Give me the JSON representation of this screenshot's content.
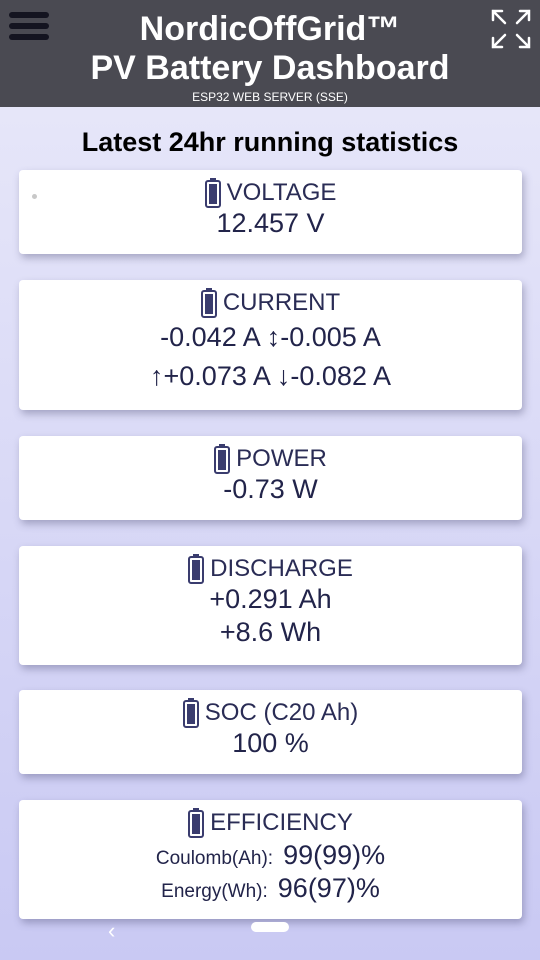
{
  "header": {
    "brand": "NordicOffGrid™",
    "title": "PV Battery Dashboard",
    "subtitle": "ESP32 WEB SERVER (SSE)",
    "menu_icon": "hamburger-menu-icon",
    "expand_icon": "fullscreen-expand-icon"
  },
  "main": {
    "heading": "Latest 24hr running statistics",
    "cards": {
      "voltage": {
        "title": "VOLTAGE",
        "value": "12.457 V"
      },
      "current": {
        "title": "CURRENT",
        "now": "-0.042 A",
        "avg": "↕-0.005 A",
        "max": "↑+0.073 A",
        "min": "↓-0.082 A"
      },
      "power": {
        "title": "POWER",
        "value": "-0.73 W"
      },
      "discharge": {
        "title": "DISCHARGE",
        "ah": "+0.291 Ah",
        "wh": "+8.6 Wh"
      },
      "soc": {
        "title": "SOC (C20 Ah)",
        "value": "100 %"
      },
      "efficiency": {
        "title": "EFFICIENCY",
        "coulomb_label": "Coulomb(Ah):",
        "coulomb_value": "99(99)%",
        "energy_label": "Energy(Wh):",
        "energy_value": "96(97)%"
      }
    },
    "battery_icon": "battery-icon",
    "accent_color": "#3a3c6e"
  },
  "system_nav": {
    "back_icon": "back-chevron-icon",
    "home_icon": "home-pill-icon"
  }
}
